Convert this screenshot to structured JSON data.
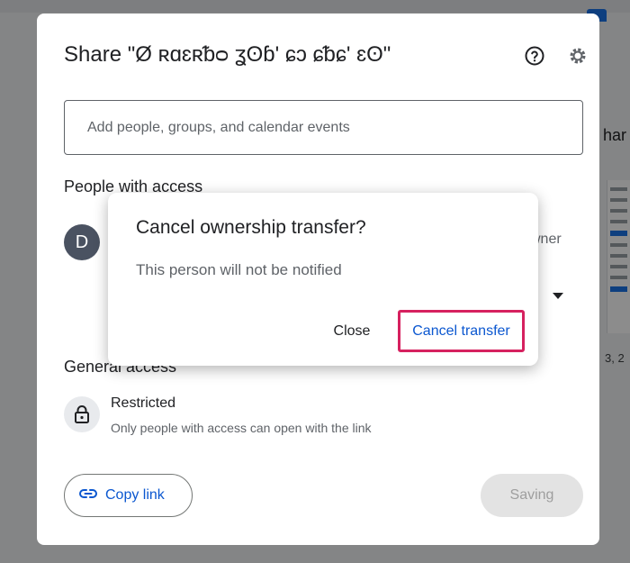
{
  "background": {
    "right_text": "har",
    "date_text": "3, 2"
  },
  "share_dialog": {
    "title": "Share \"Ø ʀɑɛʀᵬᴑ ʓʘɓ' ɕɔ ɕᵬɕ' ɛʘ\"",
    "add_placeholder": "Add people, groups, and calendar events",
    "people_heading": "People with access",
    "avatar_letter": "D",
    "owner_label": "wner",
    "general_heading": "General access",
    "access_level": "Restricted",
    "access_description": "Only people with access can open with the link",
    "copy_link_label": "Copy link",
    "saving_label": "Saving",
    "icons": {
      "help": "help-icon",
      "settings": "gear-icon",
      "lock": "lock-icon",
      "link": "link-icon"
    }
  },
  "modal": {
    "title": "Cancel ownership transfer?",
    "body": "This person will not be notified",
    "close_label": "Close",
    "confirm_label": "Cancel transfer",
    "highlight_color": "#d6215f"
  }
}
